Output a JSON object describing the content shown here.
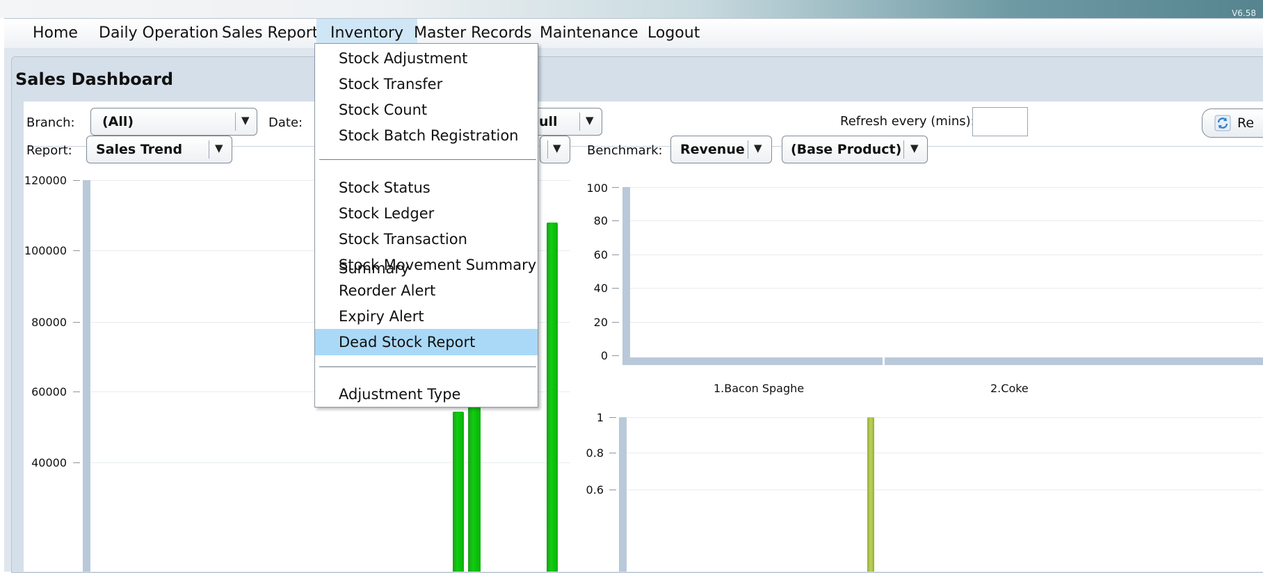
{
  "version": "V6.58",
  "menubar": {
    "items": [
      "Home",
      "Daily Operation",
      "Sales Report",
      "Inventory",
      "Master Records",
      "Maintenance",
      "Logout"
    ],
    "active": "Inventory"
  },
  "dashboard": {
    "title": "Sales Dashboard",
    "branch_label": "Branch:",
    "branch_value": "(All)",
    "date_label": "Date:",
    "date_combo_value": "ull",
    "refresh_label": "Refresh every (mins):",
    "refresh_value": "",
    "refresh_button": "Re",
    "report_label": "Report:",
    "report_value": "Sales Trend",
    "benchmark_label": "Benchmark:",
    "benchmark_value": "Revenue",
    "benchmark_product": "(Base Product)"
  },
  "inventory_menu": {
    "items": [
      "Stock Adjustment",
      "Stock Transfer",
      "Stock Count",
      "Stock Batch Registration",
      "Stock Status",
      "Stock Ledger",
      "Stock Transaction Summary",
      "Stock Movement Summary",
      "Reorder Alert",
      "Expiry Alert",
      "Dead Stock Report",
      "Adjustment Type"
    ],
    "highlighted": "Dead Stock Report"
  },
  "chart_data": [
    {
      "type": "bar",
      "title": "",
      "y_ticks": [
        "120000",
        "100000",
        "80000",
        "60000",
        "40000"
      ],
      "ylim": [
        0,
        120000
      ],
      "values_visible": [
        54000,
        58000,
        108000
      ],
      "colors": [
        "#11b511"
      ]
    },
    {
      "type": "bar",
      "title": "",
      "y_ticks": [
        "100",
        "80",
        "60",
        "40",
        "20",
        "0"
      ],
      "ylim": [
        0,
        100
      ],
      "categories": [
        "1.Bacon Spaghe",
        "2.Coke"
      ],
      "values": [
        0,
        0
      ]
    },
    {
      "type": "bar",
      "title": "",
      "y_ticks": [
        "1",
        "0.8",
        "0.6"
      ],
      "ylim": [
        0,
        1
      ],
      "values_visible": [
        1
      ],
      "colors": [
        "#a9c04a"
      ]
    }
  ]
}
